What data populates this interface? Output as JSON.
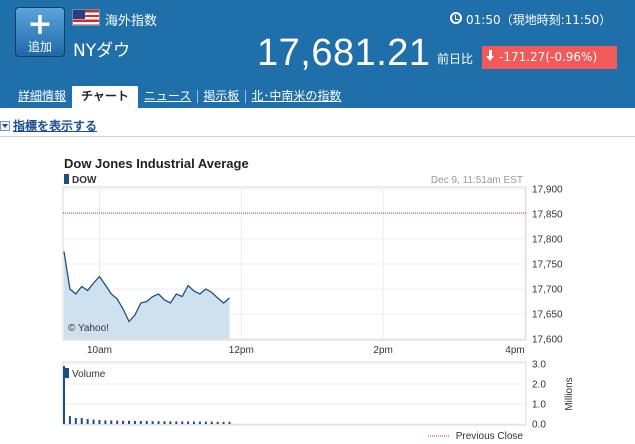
{
  "header": {
    "add_label": "追加",
    "category": "海外指数",
    "symbol": "NYダウ",
    "time": "01:50（現地時刻:11:50）",
    "price": "17,681.21",
    "prev_label": "前日比",
    "change": "-171.27(-0.96%)",
    "flag_icon": "us-flag-icon",
    "change_color": "#f25a5a",
    "header_color": "#1f6fab"
  },
  "tabs": [
    {
      "label": "詳細情報",
      "active": false
    },
    {
      "label": "チャート",
      "active": true
    },
    {
      "label": "ニュース",
      "active": false
    },
    {
      "label": "掲示板",
      "active": false
    },
    {
      "label": "北･中南米の指数",
      "active": false
    }
  ],
  "indicators_toggle": "指標を表示する",
  "chart": {
    "title": "Dow Jones Industrial Average",
    "legend": "DOW",
    "timestamp": "Dec 9, 11:51am EST",
    "watermark": "© Yahoo!",
    "volume_label": "Volume",
    "volume_axis_label": "Millions",
    "prev_close_label": "Previous Close",
    "y_ticks": [
      "17,900",
      "17,850",
      "17,800",
      "17,750",
      "17,700",
      "17,650",
      "17,600"
    ],
    "x_ticks": [
      "10am",
      "12pm",
      "2pm",
      "4pm"
    ],
    "vol_ticks": [
      "3.0",
      "2.0",
      "1.0",
      "0.0"
    ]
  },
  "chart_data": {
    "type": "area",
    "title": "Dow Jones Industrial Average",
    "series": [
      {
        "name": "DOW",
        "x": [
          "09:30",
          "09:35",
          "09:40",
          "09:45",
          "09:50",
          "09:55",
          "10:00",
          "10:05",
          "10:10",
          "10:15",
          "10:20",
          "10:25",
          "10:30",
          "10:35",
          "10:40",
          "10:45",
          "10:50",
          "10:55",
          "11:00",
          "11:05",
          "11:10",
          "11:15",
          "11:20",
          "11:25",
          "11:30",
          "11:35",
          "11:40",
          "11:45",
          "11:50"
        ],
        "values": [
          17775,
          17700,
          17690,
          17705,
          17697,
          17712,
          17725,
          17708,
          17690,
          17680,
          17660,
          17635,
          17648,
          17672,
          17675,
          17685,
          17690,
          17678,
          17672,
          17690,
          17685,
          17707,
          17696,
          17690,
          17700,
          17693,
          17682,
          17672,
          17682
        ]
      }
    ],
    "previous_close": 17852,
    "ylim": [
      17600,
      17900
    ],
    "xlim": [
      "09:30",
      "16:00"
    ],
    "volume_values_millions": [
      2.9,
      0.4,
      0.3,
      0.3,
      0.25,
      0.22,
      0.2,
      0.18,
      0.18,
      0.17,
      0.16,
      0.16,
      0.15,
      0.15,
      0.15,
      0.14,
      0.14,
      0.14,
      0.13,
      0.13,
      0.13,
      0.13,
      0.12,
      0.12,
      0.12,
      0.12,
      0.11,
      0.11,
      0.11
    ],
    "volume_ylim": [
      0,
      3.0
    ],
    "grid": true,
    "line_color": "#1c4f86",
    "fill_color": "#cfe1ef",
    "prev_close_color": "#c0392b"
  }
}
